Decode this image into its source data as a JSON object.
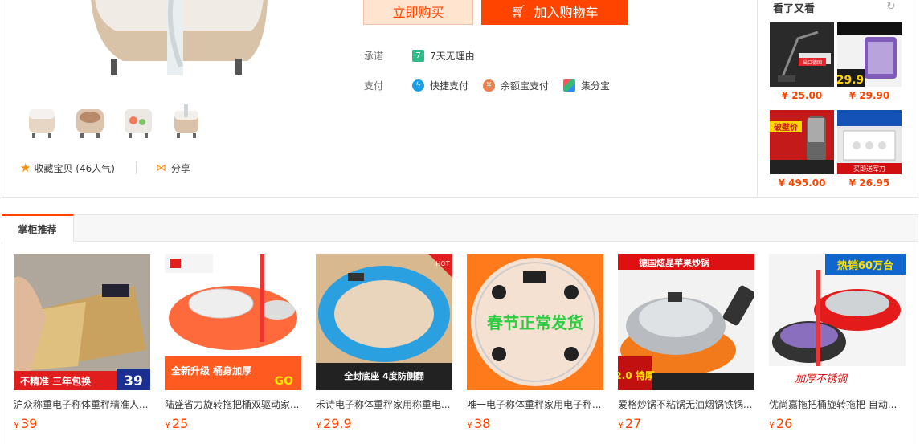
{
  "product": {
    "fav_label": "收藏宝贝",
    "fav_count": "(46人气)",
    "share_label": "分享",
    "buy_now_label": "立即购买",
    "add_cart_label": "加入购物车",
    "promise_label": "承诺",
    "promise_value": "7天无理由",
    "pay_label": "支付",
    "pay_methods": [
      "快捷支付",
      "余额宝支付",
      "集分宝"
    ]
  },
  "side": {
    "title": "看了又看",
    "items": [
      {
        "price": "¥ 25.00",
        "badge": "出口德国"
      },
      {
        "price": "¥ 29.90",
        "badge": "29.9"
      },
      {
        "price": "¥ 495.00",
        "badge": "破壁价"
      },
      {
        "price": "¥ 26.95",
        "badge": "买即送军刀"
      }
    ]
  },
  "recommend": {
    "tab_label": "掌柜推荐",
    "items": [
      {
        "title": "沪众称重电子称体重秤精准人...",
        "currency": "¥",
        "price": "39",
        "banner": "不精准 三年包换",
        "tag": "39"
      },
      {
        "title": "陆盛省力旋转拖把桶双驱动家...",
        "currency": "¥",
        "price": "25",
        "banner": "全新升级 桶身加厚",
        "tag": "GO"
      },
      {
        "title": "禾诗电子称体重秤家用称重电...",
        "currency": "¥",
        "price": "29.9",
        "banner": "全封底座 4度防侧翻",
        "tag": "HOT"
      },
      {
        "title": "唯一电子称体重秤家用电子秤...",
        "currency": "¥",
        "price": "38",
        "banner": "春节正常发货",
        "tag": ""
      },
      {
        "title": "爱格炒锅不粘锅无油烟锅铁锅...",
        "currency": "¥",
        "price": "27",
        "banner": "德国炫晶苹果炒锅",
        "tag": "2.0 特厚"
      },
      {
        "title": "优尚嘉拖把桶旋转拖把 自动...",
        "currency": "¥",
        "price": "26",
        "banner": "热销60万台",
        "tag": "加厚不锈钢"
      }
    ]
  },
  "colors": {
    "accent": "#ff4400",
    "price": "#ff4400"
  }
}
